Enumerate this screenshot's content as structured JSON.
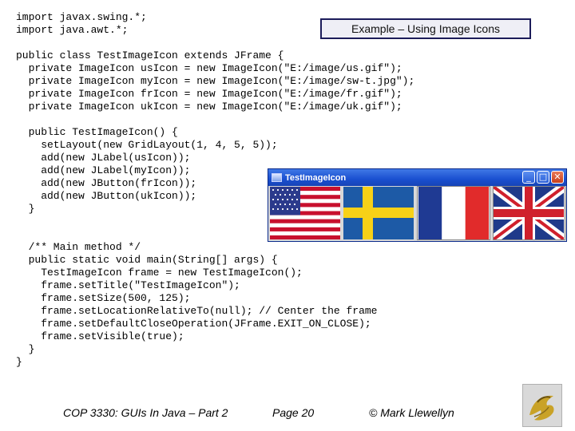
{
  "slide_title": "Example – Using Image Icons",
  "code_lines": [
    "import javax.swing.*;",
    "import java.awt.*;",
    "",
    "public class TestImageIcon extends JFrame {",
    "  private ImageIcon usIcon = new ImageIcon(\"E:/image/us.gif\");",
    "  private ImageIcon myIcon = new ImageIcon(\"E:/image/sw-t.jpg\");",
    "  private ImageIcon frIcon = new ImageIcon(\"E:/image/fr.gif\");",
    "  private ImageIcon ukIcon = new ImageIcon(\"E:/image/uk.gif\");",
    "",
    "  public TestImageIcon() {",
    "    setLayout(new GridLayout(1, 4, 5, 5));",
    "    add(new JLabel(usIcon));",
    "    add(new JLabel(myIcon));",
    "    add(new JButton(frIcon));",
    "    add(new JButton(ukIcon));",
    "  }",
    "",
    "",
    "  /** Main method */",
    "  public static void main(String[] args) {",
    "    TestImageIcon frame = new TestImageIcon();",
    "    frame.setTitle(\"TestImageIcon\");",
    "    frame.setSize(500, 125);",
    "    frame.setLocationRelativeTo(null); // Center the frame",
    "    frame.setDefaultCloseOperation(JFrame.EXIT_ON_CLOSE);",
    "    frame.setVisible(true);",
    "  }",
    "}"
  ],
  "window": {
    "title": "TestImageIcon",
    "minimize_glyph": "_",
    "maximize_glyph": "□",
    "close_glyph": "✕",
    "cells": [
      {
        "kind": "label",
        "icon": "us-flag-icon"
      },
      {
        "kind": "label",
        "icon": "sweden-flag-icon"
      },
      {
        "kind": "button",
        "icon": "france-flag-icon"
      },
      {
        "kind": "button",
        "icon": "uk-flag-icon"
      }
    ]
  },
  "footer": {
    "course": "COP 3330: GUIs In Java – Part 2",
    "page": "Page 20",
    "author": "© Mark Llewellyn"
  },
  "colors": {
    "title_border": "#1c1c5a",
    "titlebar": "#1a4fd0"
  }
}
